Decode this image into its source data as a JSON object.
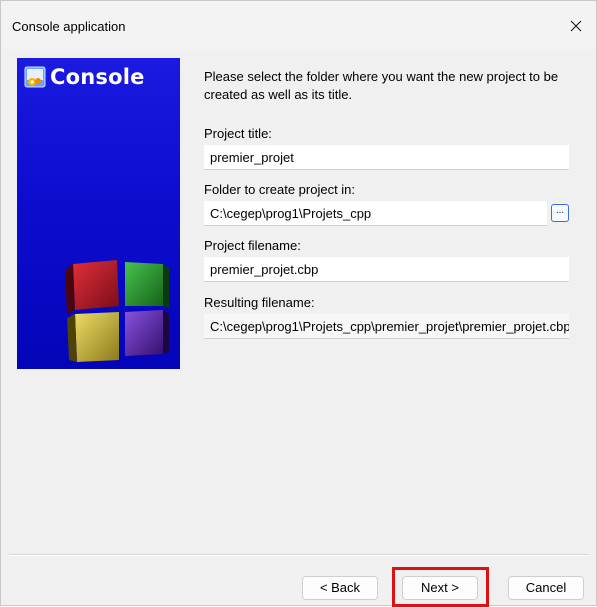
{
  "window": {
    "title": "Console application",
    "close_icon": "close-icon"
  },
  "banner": {
    "title": "Console",
    "icon": "console-app-icon",
    "background_color": "#0a0ad0"
  },
  "form": {
    "intro": "Please select the folder where you want the new project to be created as well as its title.",
    "project_title_label": "Project title:",
    "project_title_value": "premier_projet",
    "folder_label": "Folder to create project in:",
    "folder_value": "C:\\cegep\\prog1\\Projets_cpp",
    "browse_label": "...",
    "filename_label": "Project filename:",
    "filename_value": "premier_projet.cbp",
    "resulting_label": "Resulting filename:",
    "resulting_value": "C:\\cegep\\prog1\\Projets_cpp\\premier_projet\\premier_projet.cbp"
  },
  "buttons": {
    "back": "< Back",
    "next": "Next >",
    "cancel": "Cancel"
  },
  "highlight_color": "#e01010"
}
